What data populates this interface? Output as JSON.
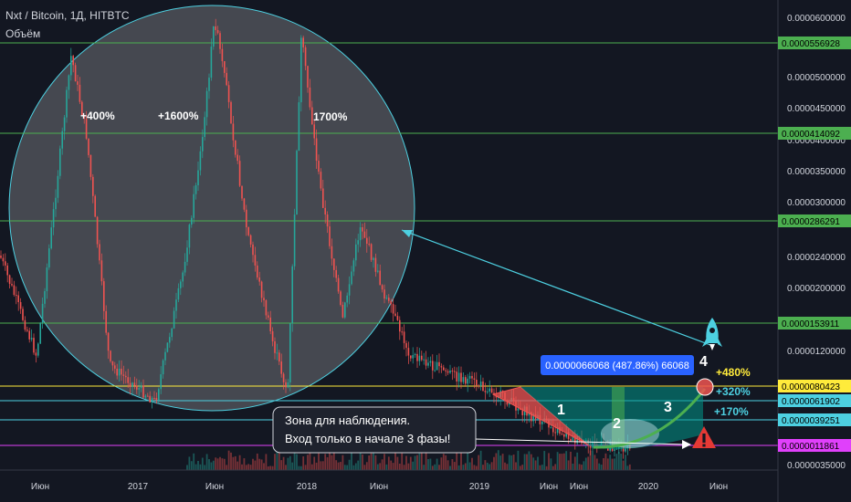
{
  "header": {
    "title": "Nxt / Bitcoin, 1Д, HITBTC",
    "indicator": "Объём"
  },
  "colors": {
    "background": "#131722",
    "up": "#26a69a",
    "down": "#ef5350",
    "level_line": "#4caf50",
    "highlight_line": "#ffeb3b",
    "cyan": "#4dd0e1"
  },
  "chart_data": {
    "type": "candlestick",
    "title": "",
    "xlabel": "",
    "ylabel": "",
    "x_ticks": [
      "Июн",
      "2017",
      "Июн",
      "2018",
      "Июн",
      "2019",
      "Июн",
      "Июн",
      "2020",
      "Июн"
    ],
    "y_ticks": [
      "0.0000600000",
      "0.0000500000",
      "0.0000450000",
      "0.0000400000",
      "0.0000350000",
      "0.0000300000",
      "0.0000240000",
      "0.0000200000",
      "0.0000120000",
      "0.0000080000",
      "0.0000035000"
    ],
    "price_levels": [
      {
        "label": "0.0000556928",
        "value": 5.56928e-05,
        "color": "#4caf50"
      },
      {
        "label": "0.0000414092",
        "value": 4.14092e-05,
        "color": "#4caf50"
      },
      {
        "label": "0.0000286291",
        "value": 2.86291e-05,
        "color": "#4caf50"
      },
      {
        "label": "0.0000153911",
        "value": 1.53911e-05,
        "color": "#4caf50"
      },
      {
        "label": "0.0000080423",
        "value": 8.0423e-06,
        "color": "#ffeb3b"
      },
      {
        "label": "0.0000061902",
        "value": 6.1902e-06,
        "color": "#4dd0e1"
      },
      {
        "label": "0.0000039251",
        "value": 3.9251e-06,
        "color": "#4dd0e1"
      },
      {
        "label": "0.0000011861",
        "value": 1.1861e-06,
        "color": "#e040fb"
      }
    ],
    "annotations": {
      "gain_1": "+400%",
      "gain_2": "+1600%",
      "gain_3": "1700%",
      "target_480": "+480%",
      "target_320": "+320%",
      "target_170": "+170%",
      "measure": "0.0000066068 (487.86%) 66068",
      "phase_1": "1",
      "phase_2": "2",
      "phase_3": "3",
      "phase_4": "4",
      "note_line1": "Зона для наблюдения.",
      "note_line2": "Вход только в начале 3 фазы!"
    }
  }
}
